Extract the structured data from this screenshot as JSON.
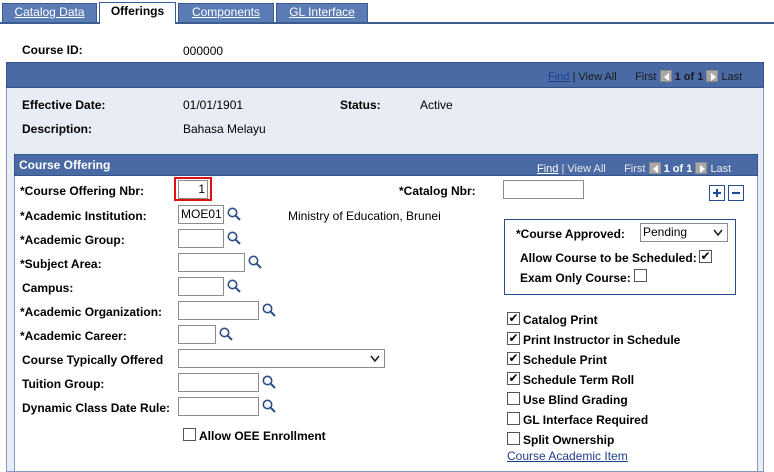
{
  "tabs": [
    {
      "label": "Catalog Data",
      "underline": "D"
    },
    {
      "label": "Offerings"
    },
    {
      "label": "Components"
    },
    {
      "label": "GL Interface"
    }
  ],
  "course": {
    "id_label": "Course ID:",
    "id_value": "000000"
  },
  "nav_top": {
    "find": "Find",
    "view_all": "View All",
    "first": "First",
    "count": "1 of 1",
    "last": "Last"
  },
  "effective": {
    "eff_date_label": "Effective Date:",
    "eff_date_value": "01/01/1901",
    "status_label": "Status:",
    "status_value": "Active",
    "desc_label": "Description:",
    "desc_value": "Bahasa Melayu"
  },
  "offering": {
    "title": "Course Offering",
    "nav": {
      "find": "Find",
      "view_all": "View All",
      "first": "First",
      "count": "1 of 1",
      "last": "Last"
    },
    "fields": {
      "offering_nbr_label": "*Course Offering Nbr:",
      "offering_nbr_value": "1",
      "catalog_nbr_label": "*Catalog Nbr:",
      "catalog_nbr_value": "",
      "institution_label": "*Academic Institution:",
      "institution_value": "MOE01",
      "institution_desc": "Ministry of Education, Brunei",
      "group_label": "*Academic Group:",
      "group_value": "",
      "subject_label": "*Subject Area:",
      "subject_value": "",
      "campus_label": "Campus:",
      "campus_value": "",
      "org_label": "*Academic Organization:",
      "org_value": "",
      "career_label": "*Academic Career:",
      "career_value": "",
      "typically_label": "Course Typically Offered",
      "typically_value": "",
      "tuition_label": "Tuition Group:",
      "tuition_value": "",
      "dynamic_label": "Dynamic Class Date Rule:",
      "dynamic_value": "",
      "oee_label": "Allow OEE Enrollment"
    },
    "approval": {
      "approved_label": "*Course Approved:",
      "approved_value": "Pending",
      "allow_sched_label": "Allow Course to be Scheduled:",
      "exam_only_label": "Exam Only Course:"
    },
    "checks": [
      {
        "label": "Catalog Print",
        "checked": true
      },
      {
        "label": "Print Instructor in Schedule",
        "checked": true
      },
      {
        "label": "Schedule Print",
        "checked": true
      },
      {
        "label": "Schedule Term Roll",
        "checked": true
      },
      {
        "label": "Use Blind Grading",
        "checked": false
      },
      {
        "label": "GL Interface Required",
        "checked": false
      },
      {
        "label": "Split Ownership",
        "checked": false
      }
    ],
    "academic_item_link": "Course Academic Item"
  }
}
